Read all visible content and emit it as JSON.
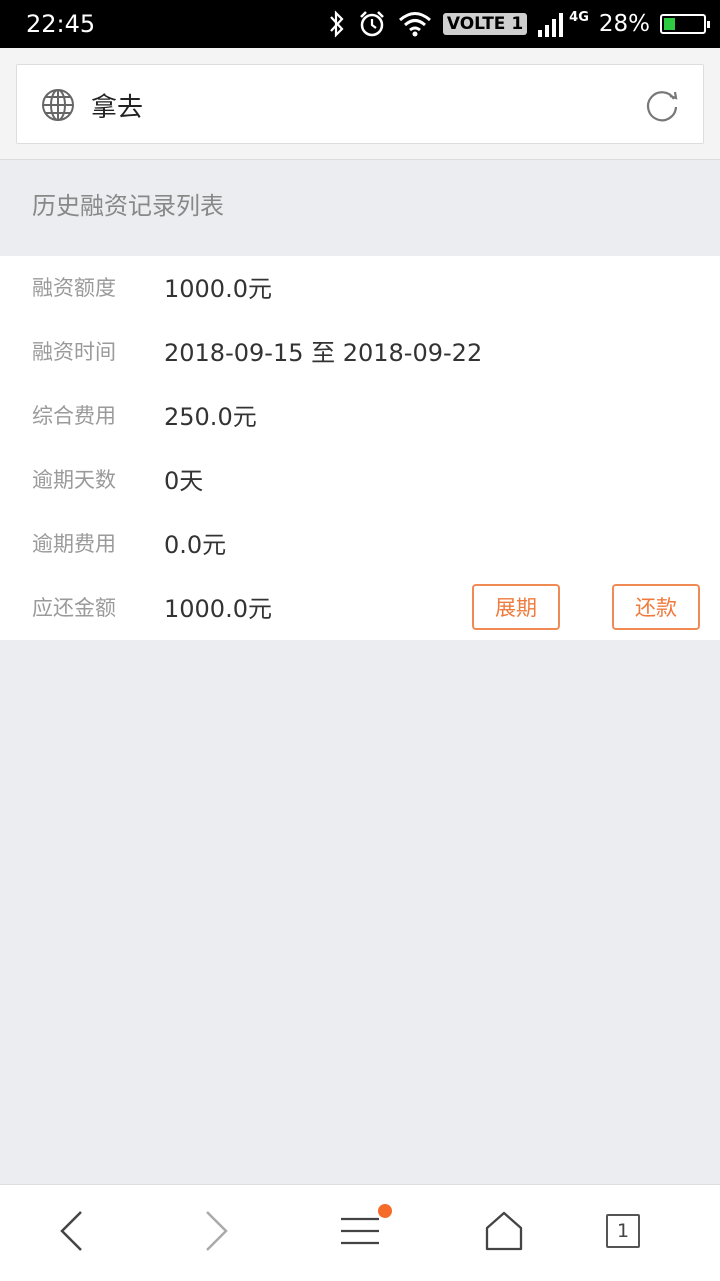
{
  "status_bar": {
    "time": "22:45",
    "volte": "VOLTE 1",
    "network": "4G",
    "battery_pct": "28%",
    "battery_level": 0.28,
    "icons": [
      "bluetooth-icon",
      "alarm-icon",
      "wifi-icon",
      "signal-icon",
      "battery-icon"
    ]
  },
  "address_bar": {
    "title": "拿去",
    "icons": [
      "globe-icon",
      "reload-icon"
    ]
  },
  "section": {
    "title": "历史融资记录列表"
  },
  "record": {
    "rows": [
      {
        "label": "融资额度",
        "value": "1000.0元"
      },
      {
        "label": "融资时间",
        "value": "2018-09-15 至 2018-09-22"
      },
      {
        "label": "综合费用",
        "value": "250.0元"
      },
      {
        "label": "逾期天数",
        "value": "0天"
      },
      {
        "label": "逾期费用",
        "value": "0.0元"
      },
      {
        "label": "应还金额",
        "value": "1000.0元"
      }
    ],
    "extend_label": "展期",
    "repay_label": "还款"
  },
  "bottom_nav": {
    "tab_count": "1",
    "icons": [
      "back-icon",
      "forward-icon",
      "menu-icon",
      "home-icon",
      "tabs-icon"
    ]
  },
  "colors": {
    "accent": "#f07a3c",
    "background": "#ebedf0",
    "notification_dot": "#f56b2a"
  }
}
